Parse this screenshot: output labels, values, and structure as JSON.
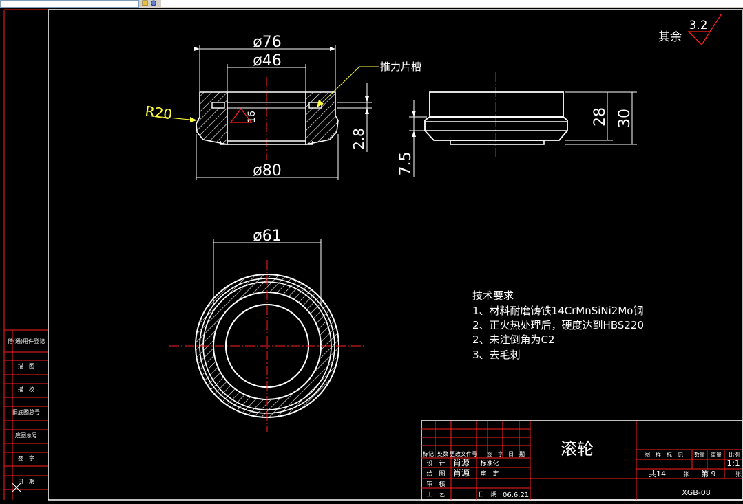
{
  "toolbar": {
    "icons": [
      "layer-icon",
      "properties-icon"
    ]
  },
  "roughness": {
    "prefix": "其余",
    "value": "3.2"
  },
  "front_view": {
    "dims": {
      "d76": "ø76",
      "d46": "ø46",
      "d80": "ø80",
      "r20": "R20",
      "h16": "16",
      "h2_8": "2.8",
      "slot_label": "推力片槽"
    }
  },
  "side_view": {
    "dims": {
      "h28": "28",
      "h30": "30",
      "h7_5": "7.5"
    }
  },
  "top_view": {
    "dims": {
      "d61": "ø61"
    }
  },
  "tech_requirements": {
    "title": "技术要求",
    "items": [
      "1、材料耐磨铸铁14CrMnSiNi2Mo钢",
      "2、正火热处理后，硬度达到HBS220",
      "2、未注倒角为C2",
      "3、去毛刺"
    ]
  },
  "left_column": {
    "cells": [
      "借(通)用件登记",
      "描　图",
      "描　校",
      "旧底图总号",
      "底图总号",
      "签　字",
      "日　期"
    ]
  },
  "title_block": {
    "part_name": "滚轮",
    "drawing_no": "XGB-08",
    "change_header": [
      "标记",
      "处数",
      "更改文件号",
      "签　字",
      "日　期"
    ],
    "rows": [
      {
        "role": "设　计",
        "name": "肖源",
        "role2": "标准化",
        "value2": ""
      },
      {
        "role": "绘　图",
        "name": "肖源",
        "role2": "审　定",
        "value2": ""
      },
      {
        "role": "审　核",
        "name": "",
        "role2": "",
        "value2": ""
      },
      {
        "role": "工　艺",
        "name": "",
        "role2": "日　期",
        "value2": "06.6.21"
      }
    ],
    "right_header": [
      "图　样　标　记",
      "数量",
      "重量",
      "比例"
    ],
    "scale": "1:1",
    "sheets_total": "共14",
    "sheets_label": "张",
    "sheet_no": "第 9",
    "sheet_label": "张"
  }
}
